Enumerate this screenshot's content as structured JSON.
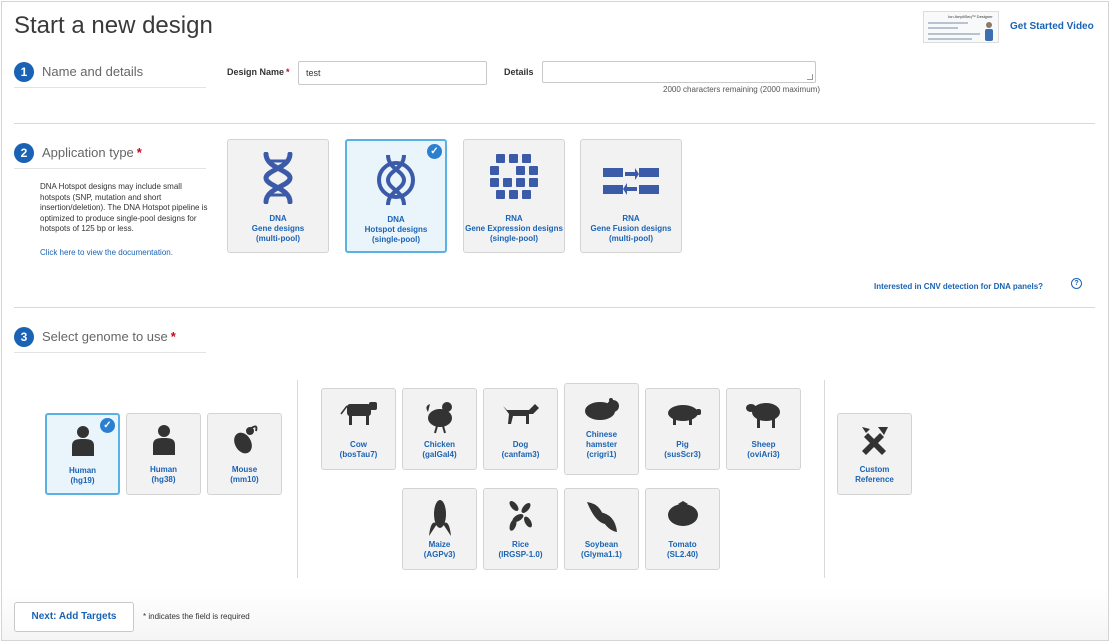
{
  "page_title": "Start a new design",
  "video": {
    "thumb_title": "Ion AmpliSeq™ Designer",
    "link": "Get Started Video"
  },
  "step1": {
    "num": "1",
    "label": "Name and details"
  },
  "design_name": {
    "label": "Design Name",
    "required": "*",
    "value": "test"
  },
  "details": {
    "label": "Details",
    "value": "",
    "remaining": "2000 characters remaining (2000 maximum)"
  },
  "step2": {
    "num": "2",
    "label": "Application type",
    "required": "*"
  },
  "app_description": "DNA Hotspot designs may include small hotspots (SNP, mutation and short insertion/deletion). The DNA Hotspot pipeline is optimized to produce single-pool designs for hotspots of 125 bp or less.",
  "doc_link": "Click here to view the documentation.",
  "app_types": [
    {
      "line1": "DNA",
      "line2": "Gene designs",
      "line3": "(multi-pool)",
      "icon": "dna-helix-icon",
      "selected": false
    },
    {
      "line1": "DNA",
      "line2": "Hotspot designs",
      "line3": "(single-pool)",
      "icon": "dna-hotspot-icon",
      "selected": true
    },
    {
      "line1": "RNA",
      "line2": "Gene Expression designs",
      "line3": "(single-pool)",
      "icon": "rna-expression-icon",
      "selected": false
    },
    {
      "line1": "RNA",
      "line2": "Gene Fusion designs",
      "line3": "(multi-pool)",
      "icon": "rna-fusion-icon",
      "selected": false
    }
  ],
  "cnv_link": "Interested in CNV detection for DNA panels?",
  "help": "?",
  "step3": {
    "num": "3",
    "label": "Select genome to use",
    "required": "*"
  },
  "genomes": {
    "common": [
      {
        "name": "Human",
        "build": "(hg19)",
        "icon": "human-icon",
        "selected": true
      },
      {
        "name": "Human",
        "build": "(hg38)",
        "icon": "human-icon",
        "selected": false
      },
      {
        "name": "Mouse",
        "build": "(mm10)",
        "icon": "mouse-icon",
        "selected": false
      }
    ],
    "others": [
      {
        "name": "Cow",
        "build": "(bosTau7)",
        "icon": "cow-icon"
      },
      {
        "name": "Chicken",
        "build": "(galGal4)",
        "icon": "chicken-icon"
      },
      {
        "name": "Dog",
        "build": "(canfam3)",
        "icon": "dog-icon"
      },
      {
        "name": "Chinese hamster",
        "build": "(crigri1)",
        "icon": "hamster-icon"
      },
      {
        "name": "Pig",
        "build": "(susScr3)",
        "icon": "pig-icon"
      },
      {
        "name": "Sheep",
        "build": "(oviAri3)",
        "icon": "sheep-icon"
      },
      {
        "name": "Maize",
        "build": "(AGPv3)",
        "icon": "corn-icon"
      },
      {
        "name": "Rice",
        "build": "(IRGSP-1.0)",
        "icon": "rice-icon"
      },
      {
        "name": "Soybean",
        "build": "(Glyma1.1)",
        "icon": "soybean-icon"
      },
      {
        "name": "Tomato",
        "build": "(SL2.40)",
        "icon": "tomato-icon"
      }
    ],
    "custom": {
      "name": "Custom",
      "build": "Reference",
      "icon": "tools-icon"
    }
  },
  "next_button": "Next: Add Targets",
  "required_note": "* indicates the field is required",
  "colors": {
    "link": "#1a63b4",
    "step_badge": "#1a63b4",
    "selected_border": "#5ab1e4",
    "selected_bg": "#eaf4fb",
    "required": "#d0021b",
    "icon": "#3b5aa8",
    "animal": "#333333"
  }
}
